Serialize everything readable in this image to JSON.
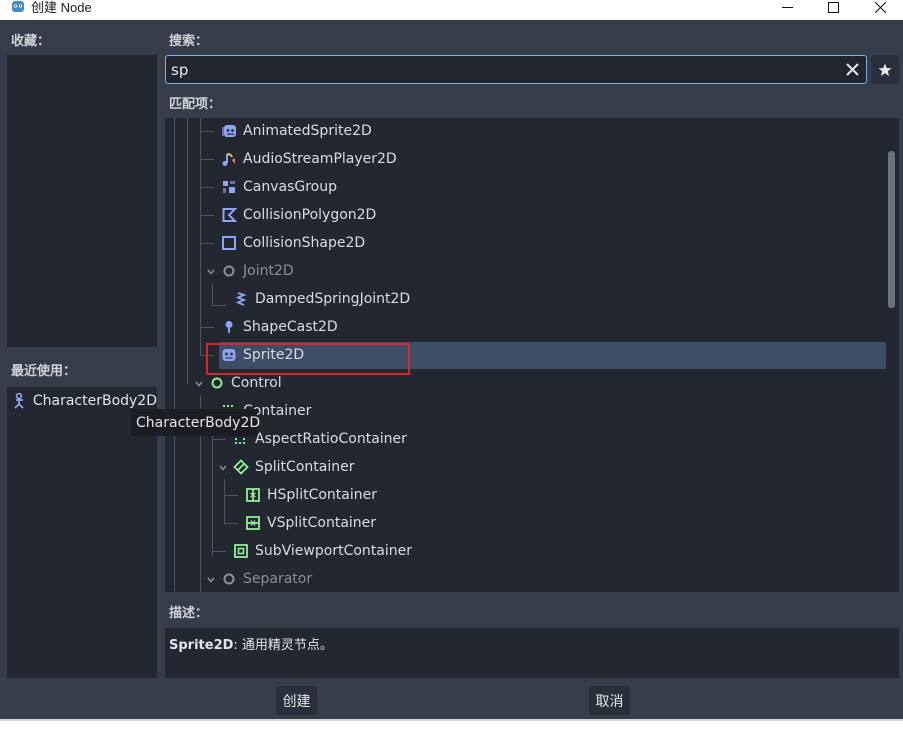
{
  "window": {
    "title": "创建 Node",
    "minimize_label": "—",
    "maximize_label": "☐",
    "close_label": "✕"
  },
  "favorites": {
    "label": "收藏："
  },
  "recent": {
    "label": "最近使用：",
    "items": [
      {
        "label": "CharacterBody2D",
        "icon": "character-body-2d-icon"
      }
    ]
  },
  "search": {
    "label": "搜索：",
    "value": "sp",
    "placeholder": ""
  },
  "matches": {
    "label": "匹配项：",
    "items": [
      {
        "label": "AnimatedSprite2D",
        "icon": "animated-sprite-icon"
      },
      {
        "label": "AudioStreamPlayer2D",
        "icon": "audio-stream-icon"
      },
      {
        "label": "CanvasGroup",
        "icon": "canvas-group-icon"
      },
      {
        "label": "CollisionPolygon2D",
        "icon": "collision-polygon-icon"
      },
      {
        "label": "CollisionShape2D",
        "icon": "collision-shape-icon"
      },
      {
        "label": "Joint2D",
        "icon": "joint-icon"
      },
      {
        "label": "DampedSpringJoint2D",
        "icon": "spring-joint-icon"
      },
      {
        "label": "ShapeCast2D",
        "icon": "shape-cast-icon"
      },
      {
        "label": "Sprite2D",
        "icon": "sprite-icon"
      },
      {
        "label": "Control",
        "icon": "control-icon"
      },
      {
        "label": "Container",
        "icon": "container-icon"
      },
      {
        "label": "AspectRatioContainer",
        "icon": "aspect-ratio-icon"
      },
      {
        "label": "SplitContainer",
        "icon": "split-container-icon"
      },
      {
        "label": "HSplitContainer",
        "icon": "hsplit-icon"
      },
      {
        "label": "VSplitContainer",
        "icon": "vsplit-icon"
      },
      {
        "label": "SubViewportContainer",
        "icon": "subviewport-icon"
      },
      {
        "label": "Separator",
        "icon": "separator-icon"
      }
    ]
  },
  "tooltip": {
    "text": "CharacterBody2D"
  },
  "description": {
    "label": "描述：",
    "node_name": "Sprite2D",
    "text": ": 通用精灵节点。"
  },
  "buttons": {
    "create": "创建",
    "cancel": "取消"
  },
  "colors": {
    "accent": "#7eb3e8",
    "node2d_blue": "#8da5f3",
    "control_green": "#8eef97",
    "selection": "#3d4d66",
    "highlight_red": "#d8262a"
  }
}
